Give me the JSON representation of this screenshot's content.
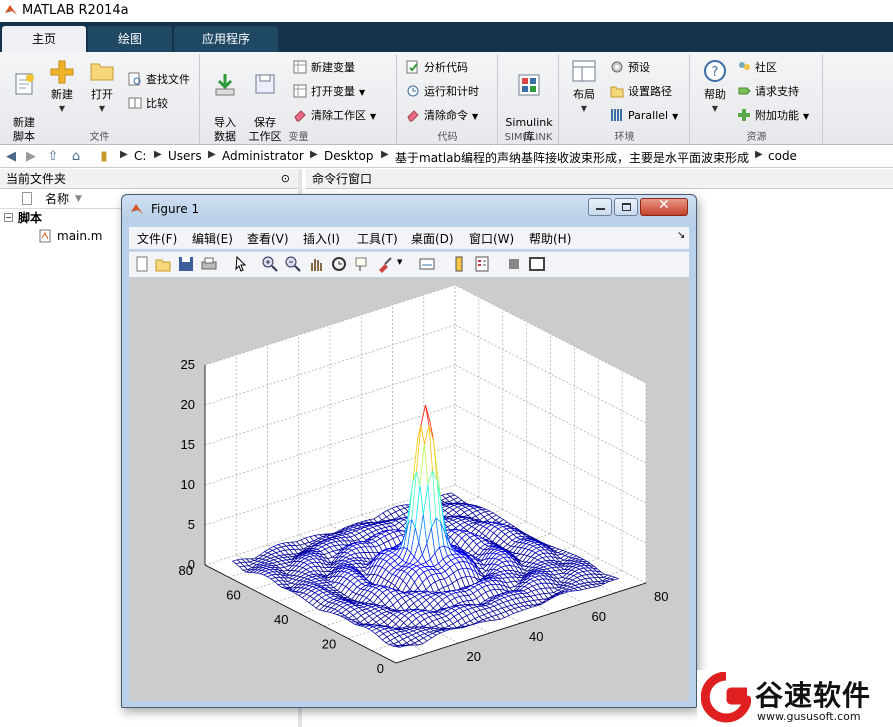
{
  "app": {
    "title": "MATLAB R2014a"
  },
  "tabs": [
    "主页",
    "绘图",
    "应用程序"
  ],
  "ribbon": {
    "file": {
      "label": "文件",
      "new_script": "新建\n脚本",
      "new": "新建",
      "open": "打开",
      "find_files": "查找文件",
      "compare": "比较"
    },
    "variable": {
      "label": "变量",
      "import_data": "导入\n数据",
      "save_workspace": "保存\n工作区",
      "new_variable": "新建变量",
      "open_variable": "打开变量",
      "clear_workspace": "清除工作区"
    },
    "code": {
      "label": "代码",
      "analyze_code": "分析代码",
      "run_and_time": "运行和计时",
      "clear_commands": "清除命令"
    },
    "simulink": {
      "label": "SIMULINK",
      "simulink_library": "Simulink\n库"
    },
    "environment": {
      "label": "环境",
      "layout": "布局",
      "preferences": "预设",
      "set_path": "设置路径",
      "parallel": "Parallel"
    },
    "resources": {
      "label": "资源",
      "help": "帮助",
      "community": "社区",
      "request_support": "请求支持",
      "add_ons": "附加功能"
    }
  },
  "address": {
    "path": [
      "C:",
      "Users",
      "Administrator",
      "Desktop",
      "基于matlab编程的声纳基阵接收波束形成，主要是水平面波束形成",
      "code"
    ]
  },
  "current_folder": {
    "title": "当前文件夹",
    "name_column": "名称",
    "group": "脚本",
    "files": [
      "main.m"
    ]
  },
  "command_window": {
    "title": "命令行窗口"
  },
  "figure": {
    "title": "Figure 1",
    "menus": [
      "文件(F)",
      "编辑(E)",
      "查看(V)",
      "插入(I)",
      "工具(T)",
      "桌面(D)",
      "窗口(W)",
      "帮助(H)"
    ]
  },
  "chart_data": {
    "type": "surface",
    "z_ticks": [
      "0",
      "5",
      "10",
      "15",
      "20",
      "25"
    ],
    "y_ticks": [
      "0",
      "20",
      "40",
      "60",
      "80"
    ],
    "x_ticks": [
      "20",
      "40",
      "60",
      "80"
    ],
    "z_range": [
      0,
      25
    ],
    "x_range": [
      0,
      80
    ],
    "y_range": [
      0,
      80
    ],
    "peak": {
      "x": 40,
      "y": 40,
      "z": 21
    },
    "grid": true,
    "colormap": "jet"
  },
  "watermark": {
    "brand": "谷速软件",
    "url": "www.gususoft.com"
  },
  "colors": {
    "tab_strip": "#143249",
    "watermark_red": "#e02020"
  }
}
